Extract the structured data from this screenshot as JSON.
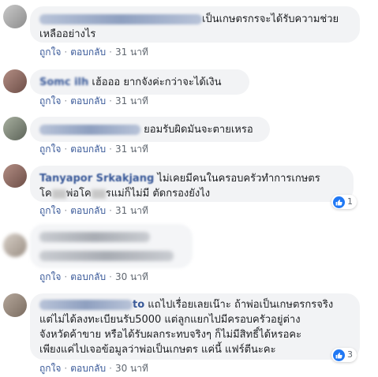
{
  "comments": [
    {
      "text": "เป็นเกษตรกรจะได้รับความช่วยเหลืออย่างไร",
      "text_line1": "เป็นเกษตรกรจะได้รับความช่วย",
      "text_line2": "เหลืออย่างไร",
      "actions": {
        "like": "ถูกใจ",
        "reply": "ตอบกลับ",
        "time": "31 นาที"
      }
    },
    {
      "author": "Somc ilh",
      "text": "เฮ้อออ ยากจังค่ะกว่าจะได้เงิน",
      "actions": {
        "like": "ถูกใจ",
        "reply": "ตอบกลับ",
        "time": "31 นาที"
      }
    },
    {
      "text": "ยอมรับผิดมันจะตายเหรอ",
      "actions": {
        "like": "ถูกใจ",
        "reply": "ตอบกลับ",
        "time": "31 นาที"
      }
    },
    {
      "author": "Tanyapor Srkakjang",
      "text_line1": "ไม่เคยมีคนในครอบครัวทำการเกษตร",
      "text_line2a": "โค",
      "text_line2b": "พ่อโค",
      "text_line2c": "รแม่ก็ไม่มี ตัดกรองยังไง",
      "reactions": "1",
      "actions": {
        "like": "ถูกใจ",
        "reply": "ตอบกลับ",
        "time": "31 นาที"
      }
    },
    {
      "actions": {
        "like": "ถูกใจ",
        "reply": "ตอบกลับ",
        "time": "30 นาที"
      }
    },
    {
      "author_suffix": "to",
      "text_line1": "แถไปเรื่อยเลยเน๊าะ ถ้าพ่อเป็นเกษตรกรจริง",
      "text_line2": "แต่ไม่ได้ลงทะเบียนรับ5000 แต่ลูกแยกไปมีครอบครัวอยู่ต่าง",
      "text_line3": "จังหวัดค้าขาย หรือได้รับผลกระทบจริงๆ ก็ไม่มีสิทธิ์ได้หรอคะ",
      "text_line4": "เพียงแค่ไปเจอข้อมูลว่าพ่อเป็นเกษตร แค่นี้ แฟร์ตีนะคะ",
      "reactions": "3",
      "actions": {
        "like": "ถูกใจ",
        "reply": "ตอบกลับ",
        "time": "30 นาที"
      }
    }
  ],
  "colors": {
    "link": "#385898",
    "bubble": "#f2f3f5",
    "like": "#2078f4"
  }
}
